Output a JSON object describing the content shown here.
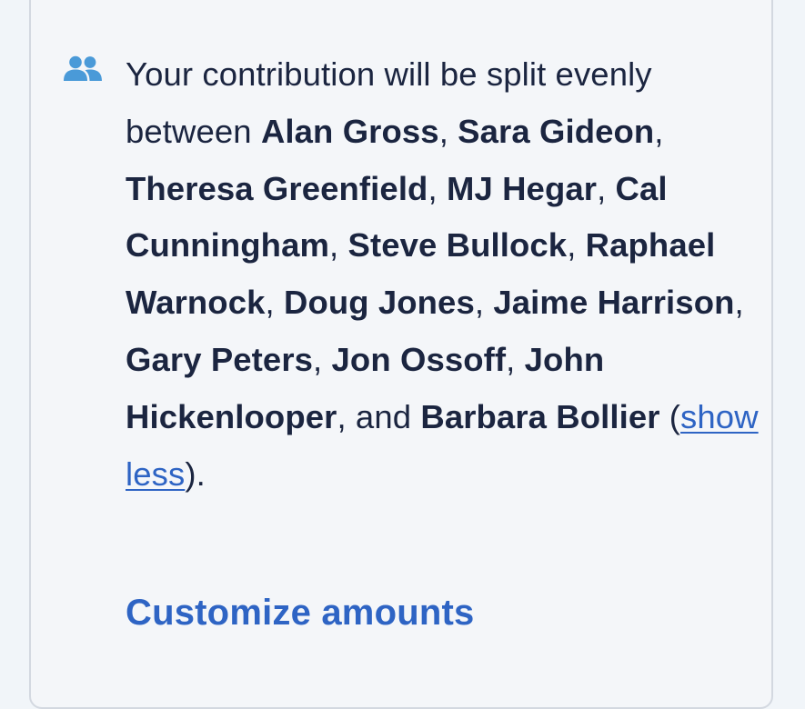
{
  "split_notice": {
    "intro": "Your contribution will be split evenly between ",
    "candidates": [
      "Alan Gross",
      "Sara Gideon",
      "Theresa Greenfield",
      "MJ Hegar",
      "Cal Cunningham",
      "Steve Bullock",
      "Raphael Warnock",
      "Doug Jones",
      "Jaime Harrison",
      "Gary Peters",
      "Jon Ossoff",
      "John Hickenlooper"
    ],
    "conjunction": ", and ",
    "last_candidate": "Barbara Bollier",
    "paren_open": " (",
    "toggle_label": "show less",
    "paren_close": ")."
  },
  "customize_label": "Customize amounts",
  "icon": "users-icon",
  "colors": {
    "text": "#1b2540",
    "link": "#2e64c4",
    "icon": "#4a9ad8",
    "card_border": "#d3d8e0"
  }
}
